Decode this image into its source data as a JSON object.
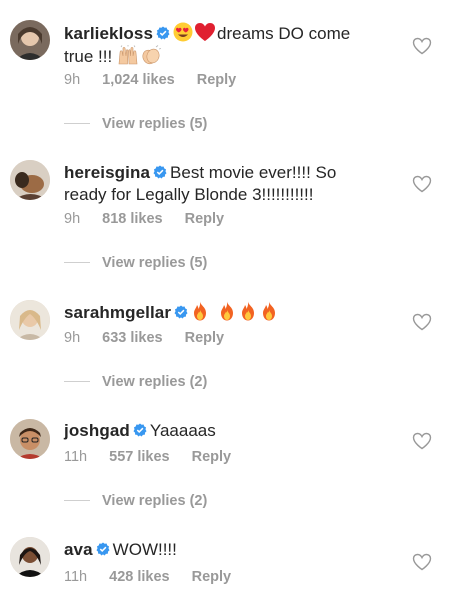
{
  "comments": [
    {
      "username": "karliekloss",
      "verified": true,
      "text_parts": [
        "dreams DO come",
        "true !!!"
      ],
      "emojis_before": [
        "heart-eyes-emoji",
        "red-heart-emoji"
      ],
      "emojis_after": [
        "raising-hands-emoji",
        "clapping-hands-emoji"
      ],
      "time": "9h",
      "likes": "1,024 likes",
      "reply": "Reply",
      "view_replies": "View replies (5)"
    },
    {
      "username": "hereisgina",
      "verified": true,
      "text": "Best movie ever!!!! So",
      "text_line2": "ready for Legally Blonde 3!!!!!!!!!!!",
      "time": "9h",
      "likes": "818 likes",
      "reply": "Reply",
      "view_replies": "View replies (5)"
    },
    {
      "username": "sarahmgellar",
      "verified": true,
      "emojis": [
        "fire-emoji",
        "fire-emoji",
        "fire-emoji",
        "fire-emoji"
      ],
      "time": "9h",
      "likes": "633 likes",
      "reply": "Reply",
      "view_replies": "View replies (2)"
    },
    {
      "username": "joshgad",
      "verified": true,
      "text": "Yaaaaas",
      "time": "11h",
      "likes": "557 likes",
      "reply": "Reply",
      "view_replies": "View replies (2)"
    },
    {
      "username": "ava",
      "verified": true,
      "text": "WOW!!!!",
      "time": "11h",
      "likes": "428 likes",
      "reply": "Reply"
    }
  ],
  "colors": {
    "verified": "#3897f0",
    "meta": "#999999",
    "text": "#262626"
  },
  "icons": {
    "like": "heart-outline-icon",
    "verified": "verified-badge-icon"
  }
}
